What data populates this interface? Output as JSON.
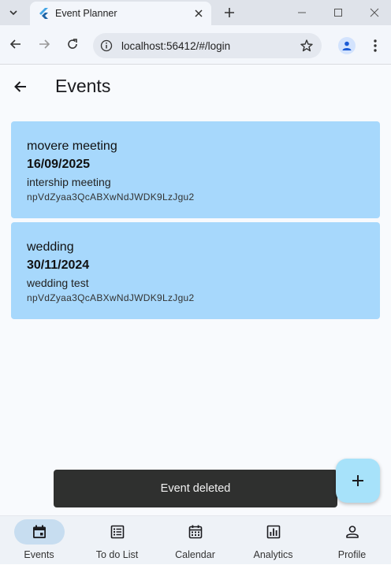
{
  "browser": {
    "tab_title": "Event Planner",
    "url": "localhost:56412/#/login"
  },
  "appbar": {
    "title": "Events"
  },
  "events": [
    {
      "title": "movere meeting",
      "date": "16/09/2025",
      "description": "intership meeting",
      "id": "npVdZyaa3QcABXwNdJWDK9LzJgu2"
    },
    {
      "title": "wedding",
      "date": "30/11/2024",
      "description": "wedding test",
      "id": "npVdZyaa3QcABXwNdJWDK9LzJgu2"
    }
  ],
  "snackbar": {
    "message": "Event deleted"
  },
  "nav": [
    {
      "label": "Events",
      "icon": "calendar-event-icon",
      "active": true
    },
    {
      "label": "To do List",
      "icon": "list-icon",
      "active": false
    },
    {
      "label": "Calendar",
      "icon": "calendar-icon",
      "active": false
    },
    {
      "label": "Analytics",
      "icon": "analytics-icon",
      "active": false
    },
    {
      "label": "Profile",
      "icon": "person-icon",
      "active": false
    }
  ],
  "colors": {
    "card": "#a7d8fc",
    "fab": "#a7e2fa",
    "nav_active": "#c7ddf0",
    "snackbar": "#2f302f"
  }
}
